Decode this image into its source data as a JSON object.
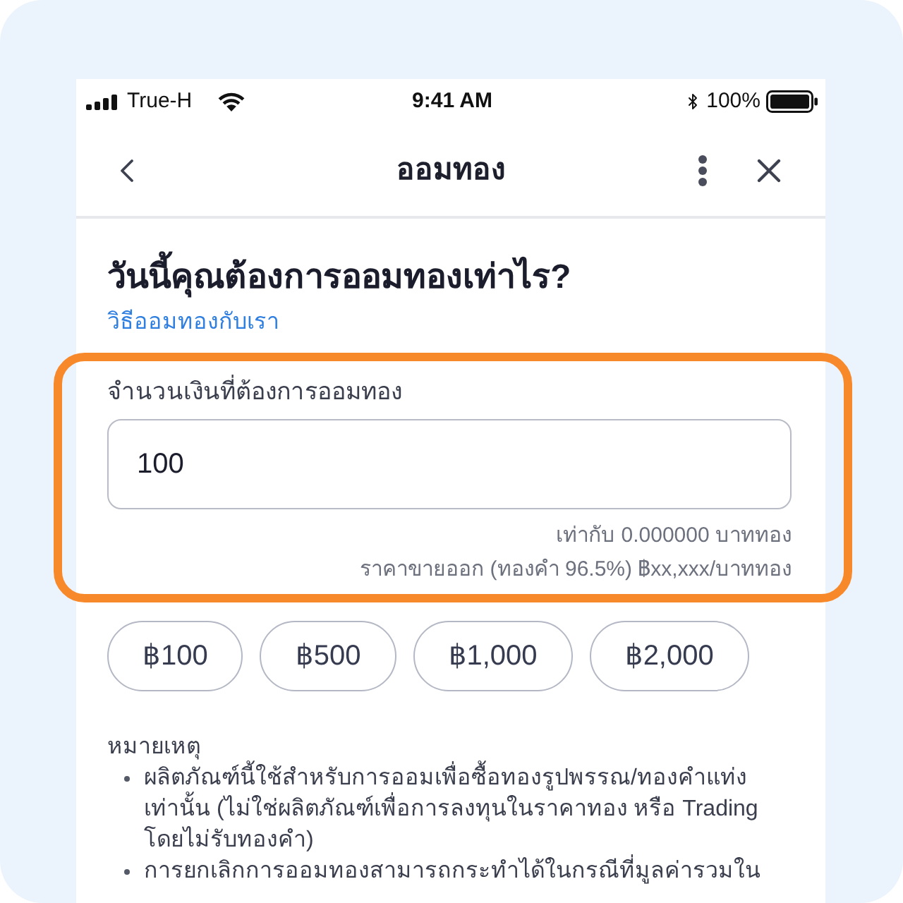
{
  "status_bar": {
    "carrier": "True-H",
    "time": "9:41 AM",
    "battery": "100%"
  },
  "nav_bar": {
    "title": "ออมทอง"
  },
  "heading": "วันนี้คุณต้องการออมทองเท่าไร?",
  "link": "วิธีออมทองกับเรา",
  "amount_field": {
    "label": "จำนวนเงินที่ต้องการออมทอง",
    "value": "100",
    "highlighted": true,
    "equivalent": "เท่ากับ 0.000000 บาททอง",
    "sell_price": "ราคาขายออก (ทองคำ 96.5%) ฿xx,xxx/บาททอง"
  },
  "quick_amounts": [
    {
      "label": "฿100",
      "selected": false
    },
    {
      "label": "฿500",
      "selected": false
    },
    {
      "label": "฿1,000",
      "selected": false
    },
    {
      "label": "฿2,000",
      "selected": false
    }
  ],
  "notes": {
    "title": "หมายเหตุ",
    "items": [
      "ผลิตภัณฑ์นี้ใช้สำหรับการออมเพื่อซื้อทองรูปพรรณ/ทองคำแท่งเท่านั้น (ไม่ใช่ผลิตภัณฑ์เพื่อการลงทุนในราคาทอง หรือ Trading โดยไม่รับทองคำ)",
      "การยกเลิกการออมทองสามารถกระทำได้ในกรณีที่มูลค่ารวมใน"
    ]
  }
}
